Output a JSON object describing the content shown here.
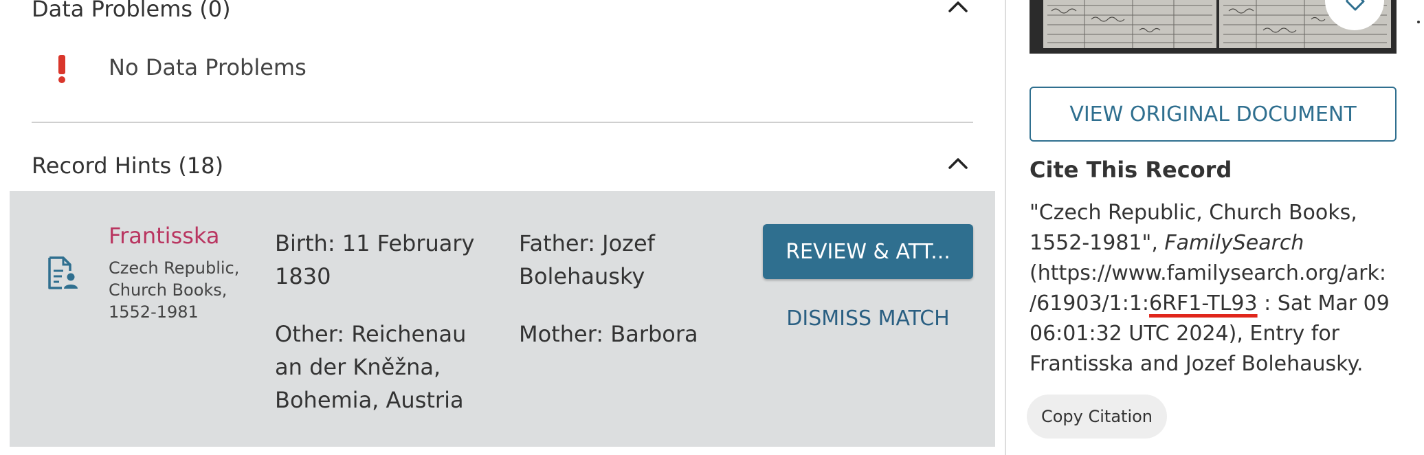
{
  "data_problems": {
    "title": "Data Problems (0)",
    "empty_message": "No Data Problems",
    "alert_icon": "exclamation-icon",
    "alert_color": "#d9362b"
  },
  "record_hints": {
    "title": "Record Hints (18)",
    "hint": {
      "name": "Frantisska",
      "collection": "Czech Republic, Church Books, 1552-1981",
      "icon": "document-person-icon",
      "birth": "Birth: 11 February 1830",
      "other": "Other: Reichenau an der Kněžna, Bohemia, Austria",
      "father": "Father: Jozef Bolehausky",
      "mother": "Mother: Barbora",
      "review_label": "REVIEW & ATT...",
      "dismiss_label": "DISMISS MATCH"
    }
  },
  "sidebar": {
    "view_original_label": "VIEW ORIGINAL DOCUMENT",
    "cite_heading": "Cite This Record",
    "citation": {
      "line1": " \"Czech Republic, Church Books,",
      "line2_prefix": "1552-1981\", ",
      "line2_italic": "FamilySearch",
      "line3": "(https://www.familysearch.org/ark:",
      "line4_prefix": "/61903/1:1:",
      "line4_highlight": "6RF1-TL93",
      "line4_suffix": " : Sat Mar 09",
      "line5": "06:01:32 UTC 2024), Entry for",
      "line6": "Frantisska and Jozef Bolehausky."
    },
    "copy_label": "Copy Citation"
  },
  "colors": {
    "primary": "#2f6f8f",
    "name_link": "#b93560",
    "card_bg": "#dcdedf",
    "highlight_underline": "#e0261b"
  }
}
